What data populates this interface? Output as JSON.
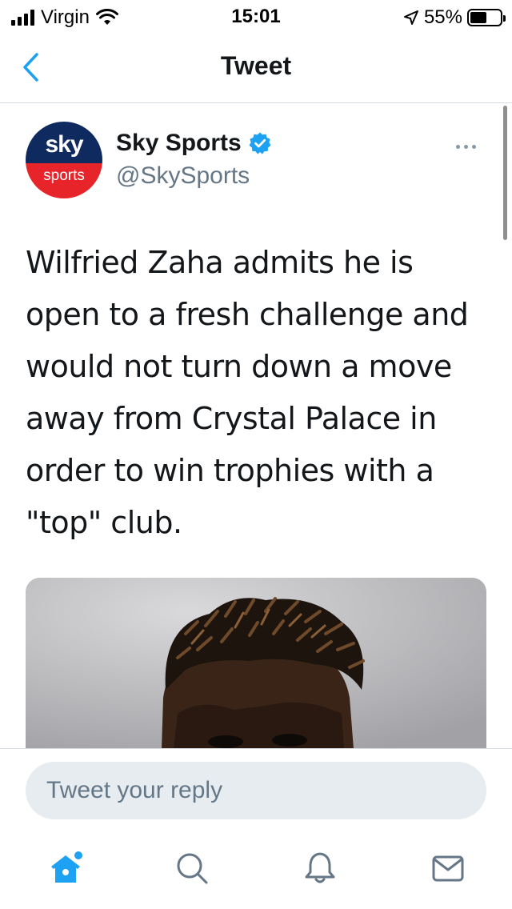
{
  "status_bar": {
    "carrier": "Virgin",
    "time": "15:01",
    "battery_percent": "55%",
    "battery_level": 0.55
  },
  "nav": {
    "title": "Tweet"
  },
  "tweet": {
    "avatar_text_top": "sky",
    "avatar_text_bottom": "sports",
    "display_name": "Sky Sports",
    "handle": "@SkySports",
    "verified": true,
    "text": "Wilfried Zaha admits he is open to a fresh challenge and would not turn down a move away from Crystal Palace in order to win trophies with a \"top\" club."
  },
  "reply": {
    "placeholder": "Tweet your reply"
  },
  "tabs": [
    {
      "name": "home",
      "icon": "home-icon",
      "active": true,
      "has_notification_dot": true
    },
    {
      "name": "search",
      "icon": "search-icon",
      "active": false
    },
    {
      "name": "notifications",
      "icon": "bell-icon",
      "active": false
    },
    {
      "name": "messages",
      "icon": "mail-icon",
      "active": false
    }
  ],
  "colors": {
    "accent": "#1da1f2",
    "text_primary": "#14171a",
    "text_secondary": "#657786",
    "icon_inactive": "#657786",
    "reply_bg": "#e6ecf0",
    "sky_blue": "#0f2a5f",
    "sky_red": "#e8242b"
  }
}
